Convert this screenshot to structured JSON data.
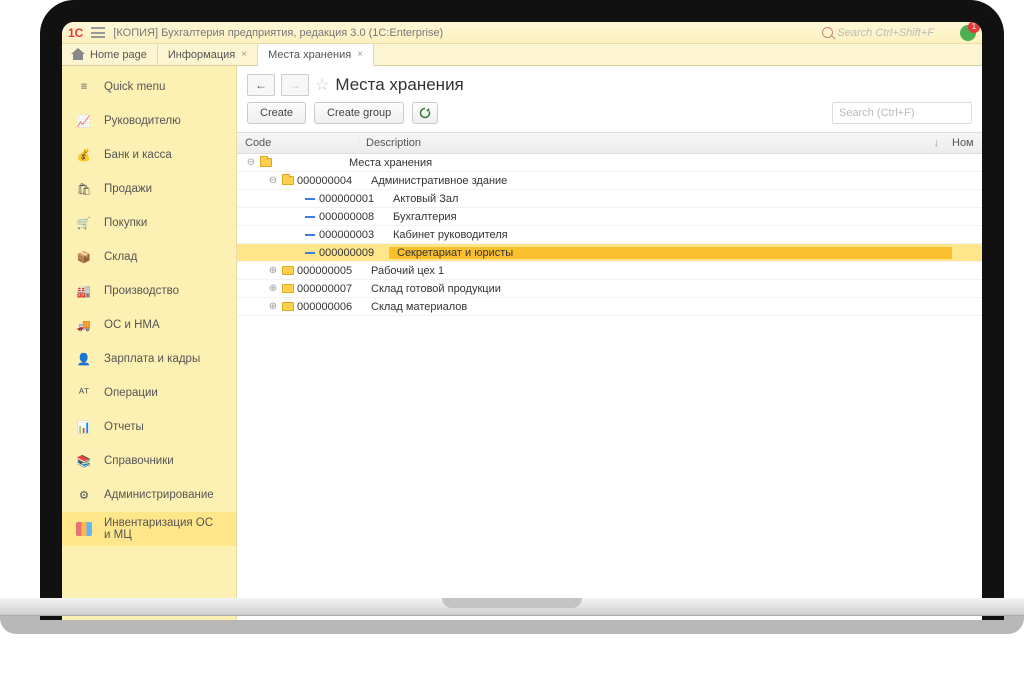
{
  "topbar": {
    "logo": "1C",
    "title": "[КОПИЯ] Бухгалтерия предприятия, редакция 3.0  (1C:Enterprise)",
    "search_placeholder": "Search Ctrl+Shift+F",
    "notify_count": "1"
  },
  "tabs": [
    {
      "label": "Home page",
      "closable": false,
      "active": false,
      "home": true
    },
    {
      "label": "Информация",
      "closable": true,
      "active": false
    },
    {
      "label": "Места хранения",
      "closable": true,
      "active": true
    }
  ],
  "sidebar": {
    "items": [
      {
        "label": "Quick menu",
        "glyph": "≡"
      },
      {
        "label": "Руководителю",
        "glyph": "📈"
      },
      {
        "label": "Банк и касса",
        "glyph": "💰"
      },
      {
        "label": "Продажи",
        "glyph": "🛍"
      },
      {
        "label": "Покупки",
        "glyph": "🛒"
      },
      {
        "label": "Склад",
        "glyph": "📦"
      },
      {
        "label": "Производство",
        "glyph": "🏭"
      },
      {
        "label": "ОС и НМА",
        "glyph": "🚚"
      },
      {
        "label": "Зарплата и кадры",
        "glyph": "👤"
      },
      {
        "label": "Операции",
        "glyph": "ᴬᵀ"
      },
      {
        "label": "Отчеты",
        "glyph": "📊"
      },
      {
        "label": "Справочники",
        "glyph": "📚"
      },
      {
        "label": "Администрирование",
        "glyph": "⚙"
      },
      {
        "label": "Инвентаризация ОС и МЦ",
        "glyph": "",
        "books": true
      }
    ]
  },
  "panel": {
    "title": "Места хранения",
    "create_label": "Create",
    "create_group_label": "Create group",
    "search_placeholder": "Search (Ctrl+F)"
  },
  "columns": {
    "code": "Code",
    "description": "Description",
    "nor": "Ном"
  },
  "tree": [
    {
      "depth": 0,
      "toggle": "⊖",
      "icon": "folder-open",
      "code": "",
      "desc": "Места хранения"
    },
    {
      "depth": 1,
      "toggle": "⊖",
      "icon": "folder-open",
      "code": "000000004",
      "desc": "Административное здание"
    },
    {
      "depth": 2,
      "toggle": "",
      "icon": "dash",
      "code": "000000001",
      "desc": "Актовый Зал"
    },
    {
      "depth": 2,
      "toggle": "",
      "icon": "dash",
      "code": "000000008",
      "desc": "Бухгалтерия"
    },
    {
      "depth": 2,
      "toggle": "",
      "icon": "dash",
      "code": "000000003",
      "desc": "Кабинет руководителя"
    },
    {
      "depth": 2,
      "toggle": "",
      "icon": "dash",
      "code": "000000009",
      "desc": "Секретариат и юристы",
      "selected": true
    },
    {
      "depth": 1,
      "toggle": "⊕",
      "icon": "folder",
      "code": "000000005",
      "desc": "Рабочий цех 1"
    },
    {
      "depth": 1,
      "toggle": "⊕",
      "icon": "folder",
      "code": "000000007",
      "desc": "Склад готовой продукции"
    },
    {
      "depth": 1,
      "toggle": "⊕",
      "icon": "folder",
      "code": "000000006",
      "desc": "Склад материалов"
    }
  ]
}
